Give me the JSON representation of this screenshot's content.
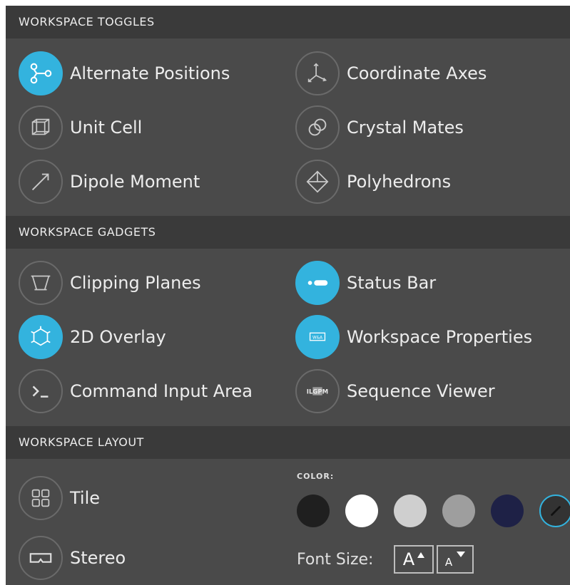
{
  "sections": {
    "toggles": "WORKSPACE TOGGLES",
    "gadgets": "WORKSPACE GADGETS",
    "layout": "WORKSPACE LAYOUT"
  },
  "toggles": {
    "alternate_positions": {
      "label": "Alternate Positions",
      "active": true
    },
    "coordinate_axes": {
      "label": "Coordinate Axes",
      "active": false
    },
    "unit_cell": {
      "label": "Unit Cell",
      "active": false
    },
    "crystal_mates": {
      "label": "Crystal Mates",
      "active": false
    },
    "dipole_moment": {
      "label": "Dipole Moment",
      "active": false
    },
    "polyhedrons": {
      "label": "Polyhedrons",
      "active": false
    }
  },
  "gadgets": {
    "clipping_planes": {
      "label": "Clipping Planes",
      "active": false
    },
    "status_bar": {
      "label": "Status Bar",
      "active": true
    },
    "overlay_2d": {
      "label": "2D Overlay",
      "active": true
    },
    "workspace_properties": {
      "label": "Workspace Properties",
      "active": true,
      "icon_text": "W&A"
    },
    "command_input": {
      "label": "Command Input Area",
      "active": false
    },
    "sequence_viewer": {
      "label": "Sequence Viewer",
      "active": false,
      "icon_text": "ILGPM"
    }
  },
  "layout": {
    "tile": {
      "label": "Tile"
    },
    "stereo": {
      "label": "Stereo"
    },
    "color_label": "COLOR:",
    "colors": [
      "#1f1f1f",
      "#ffffff",
      "#cfcfcf",
      "#9e9e9e",
      "#1e2146",
      "#33b3de"
    ],
    "font_size_label": "Font Size:",
    "font_increase_glyph": "A",
    "font_decrease_glyph": "A"
  },
  "theme": {
    "accent": "#33b3de",
    "panel": "#4a4a4a",
    "header": "#3a3a3a"
  }
}
